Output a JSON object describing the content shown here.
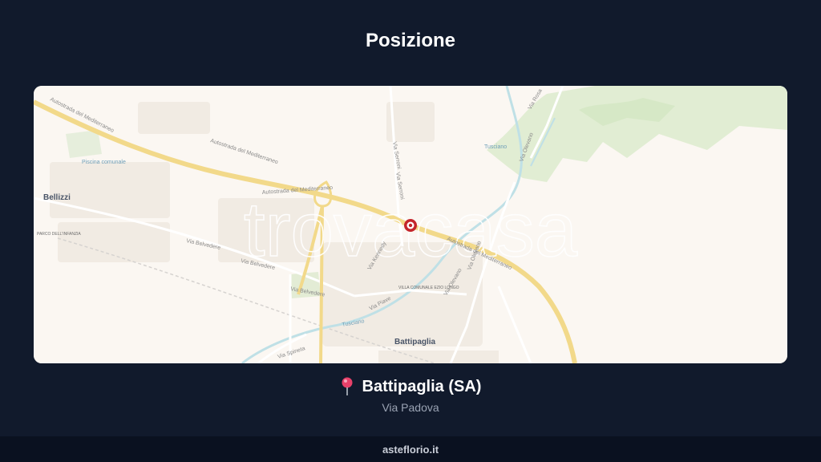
{
  "page": {
    "title": "Posizione"
  },
  "map": {
    "watermark": "trovacasa",
    "labels": {
      "autostrada_1": "Autostrada del Mediterraneo",
      "autostrada_2": "Autostrada del Mediterraneo",
      "autostrada_3": "Autostrada del Mediterraneo",
      "autostrada_4": "Autostrada del Mediterraneo",
      "bellizzi": "Bellizzi",
      "battipaglia": "Battipaglia",
      "parco": "PARCO DELL'INFANZIA",
      "piscina": "Piscina comunale",
      "via_belvedere_1": "Via Belvedere",
      "via_belvedere_2": "Via Belvedere",
      "via_belvedere_3": "Via Belvedere",
      "via_serroni_1": "Via Serroni",
      "via_serroni_2": "Via Serroni",
      "villa": "VILLA COMUNALE EZIO LONGO",
      "via_olevano_1": "Via Olevano",
      "via_olevano_2": "Via Olevano",
      "via_olevano_3": "Via Olevano",
      "via_piave": "Via Piave",
      "via_spineta": "Via Spineta",
      "via_rosa": "Via Rosa",
      "via_padova_map": "Via Padova",
      "tusciano": "Tusciano",
      "via_kennedy": "Via Kennedy"
    },
    "colors": {
      "background": "#fbf7f2",
      "highway": "#f2d98a",
      "water": "#bfe0e6",
      "green": "#e3efd6",
      "marker": "#c4252b"
    }
  },
  "location": {
    "icon": "pushpin-icon",
    "name": "Battipaglia (SA)",
    "address": "Via Padova"
  },
  "footer": {
    "text": "asteflorio.it"
  }
}
